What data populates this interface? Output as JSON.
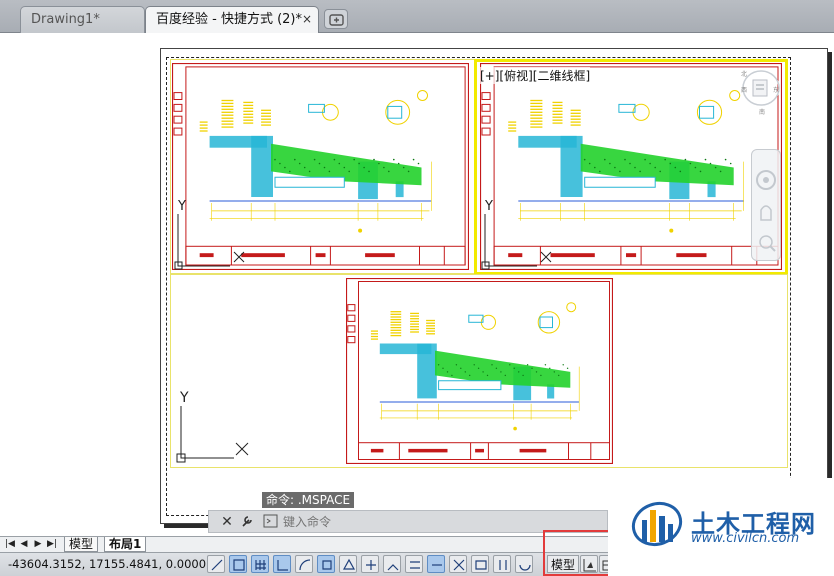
{
  "tabs": [
    {
      "label": "Drawing1*",
      "active": false
    },
    {
      "label": "百度经验 - 快捷方式 (2)*",
      "active": true,
      "close": "×"
    }
  ],
  "viewport_label": "[+][俯视][二维线框]",
  "command": {
    "history": "命令:  .MSPACE",
    "placeholder": "键入命令"
  },
  "layout_tabs": {
    "nav": [
      "|◀",
      "◀",
      "▶",
      "▶|"
    ],
    "items": [
      "模型",
      "布局1"
    ],
    "active": "布局1"
  },
  "status": {
    "coordinates": "-43604.3152, 17155.4841, 0.0000",
    "model_label": "模型"
  },
  "watermark": {
    "title": "土木工程网",
    "url": "www.civilcn.com"
  },
  "colors": {
    "viewport_active": "#f2ea00",
    "title_frame": "#c41a1a",
    "hatch_green": "#22d12b",
    "hatch_cyan": "#27b6d6",
    "note_yellow": "#f0d200",
    "watermark_blue": "#1f5fa8"
  }
}
